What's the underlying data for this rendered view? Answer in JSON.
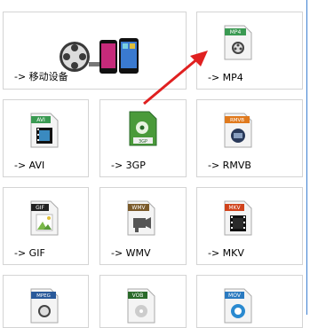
{
  "formats": [
    {
      "key": "device",
      "label": "-> 移动设备"
    },
    {
      "key": "mp4",
      "label": "-> MP4",
      "badge": "MP4",
      "badge_color": "#3a9a52"
    },
    {
      "key": "avi",
      "label": "-> AVI",
      "badge": "AVI",
      "badge_color": "#3a9a52"
    },
    {
      "key": "3gp",
      "label": "-> 3GP",
      "badge": "3GP"
    },
    {
      "key": "rmvb",
      "label": "-> RMVB",
      "badge": "RMVB",
      "badge_color": "#e07a1e"
    },
    {
      "key": "gif",
      "label": "-> GIF",
      "badge": "GIF",
      "badge_color": "#222222"
    },
    {
      "key": "wmv",
      "label": "-> WMV",
      "badge": "WMV",
      "badge_color": "#7a5a2a"
    },
    {
      "key": "mkv",
      "label": "-> MKV",
      "badge": "MKV",
      "badge_color": "#d0431c"
    },
    {
      "key": "mpeg",
      "label": "",
      "badge": "MPEG",
      "badge_color": "#2a5a9a"
    },
    {
      "key": "vob",
      "label": "",
      "badge": "VOB",
      "badge_color": "#2a6a2a"
    },
    {
      "key": "mov",
      "label": "",
      "badge": "MOV",
      "badge_color": "#2a7ac0"
    }
  ],
  "colors": {
    "tile_border": "#d4d4d4",
    "arrow": "#e02020",
    "scroll_edge": "#3d7fd1"
  }
}
